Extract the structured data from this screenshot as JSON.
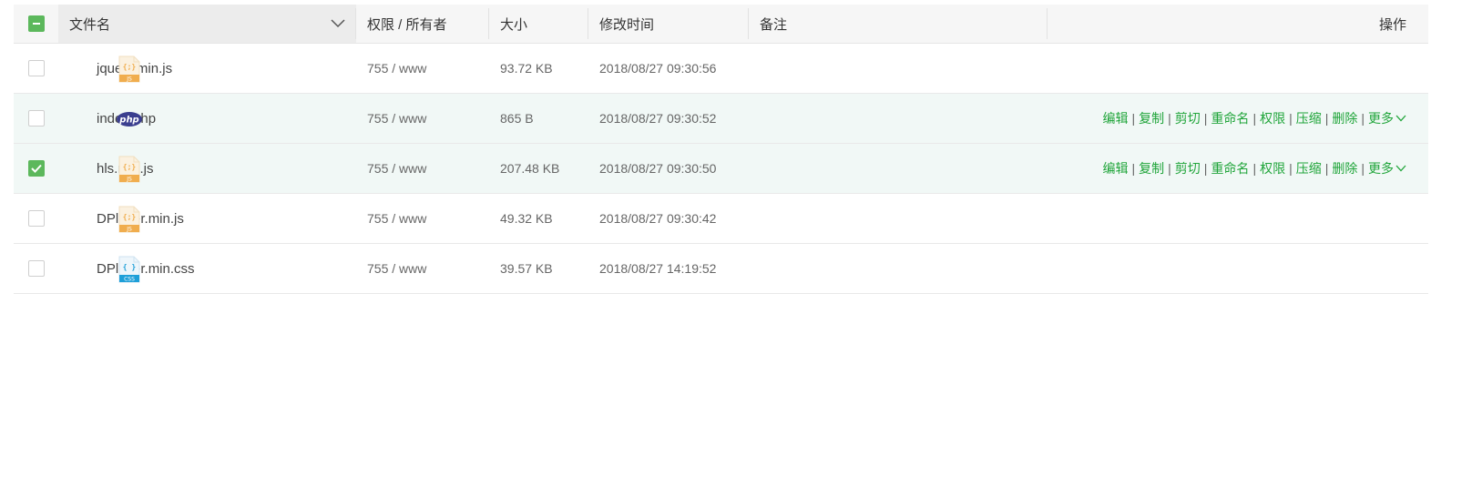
{
  "header": {
    "name": "文件名",
    "perm_owner": "权限 / 所有者",
    "size": "大小",
    "mtime": "修改时间",
    "remark": "备注",
    "ops": "操作"
  },
  "colors": {
    "accent": "#20a53a",
    "check": "#5cb85c",
    "js_icon": "#f0ad4e",
    "css_icon": "#1e9fd8",
    "php_icon": "#3b3f8f",
    "row_highlight": "#f1f8f6"
  },
  "files": [
    {
      "name": "jquery.min.js",
      "icon": "js-file-icon",
      "perm": "755 / www",
      "size": "93.72 KB",
      "mtime": "2018/08/27 09:30:56",
      "checked": false,
      "show_ops": false
    },
    {
      "name": "index.php",
      "icon": "php-file-icon",
      "perm": "755 / www",
      "size": "865 B",
      "mtime": "2018/08/27 09:30:52",
      "checked": false,
      "show_ops": true
    },
    {
      "name": "hls.min.js",
      "icon": "js-file-icon",
      "perm": "755 / www",
      "size": "207.48 KB",
      "mtime": "2018/08/27 09:30:50",
      "checked": true,
      "show_ops": true
    },
    {
      "name": "DPlayer.min.js",
      "icon": "js-file-icon",
      "perm": "755 / www",
      "size": "49.32 KB",
      "mtime": "2018/08/27 09:30:42",
      "checked": false,
      "show_ops": false
    },
    {
      "name": "DPlayer.min.css",
      "icon": "css-file-icon",
      "perm": "755 / www",
      "size": "39.57 KB",
      "mtime": "2018/08/27 14:19:52",
      "checked": false,
      "show_ops": false
    }
  ],
  "ops": {
    "edit": "编辑",
    "copy": "复制",
    "cut": "剪切",
    "rename": "重命名",
    "perm": "权限",
    "compress": "压缩",
    "delete": "删除",
    "more": "更多"
  },
  "icon_text": {
    "js_glyph": "{;}",
    "js_label": "JS",
    "css_glyph": "{ }",
    "css_label": "CSS",
    "php_label": "php"
  }
}
